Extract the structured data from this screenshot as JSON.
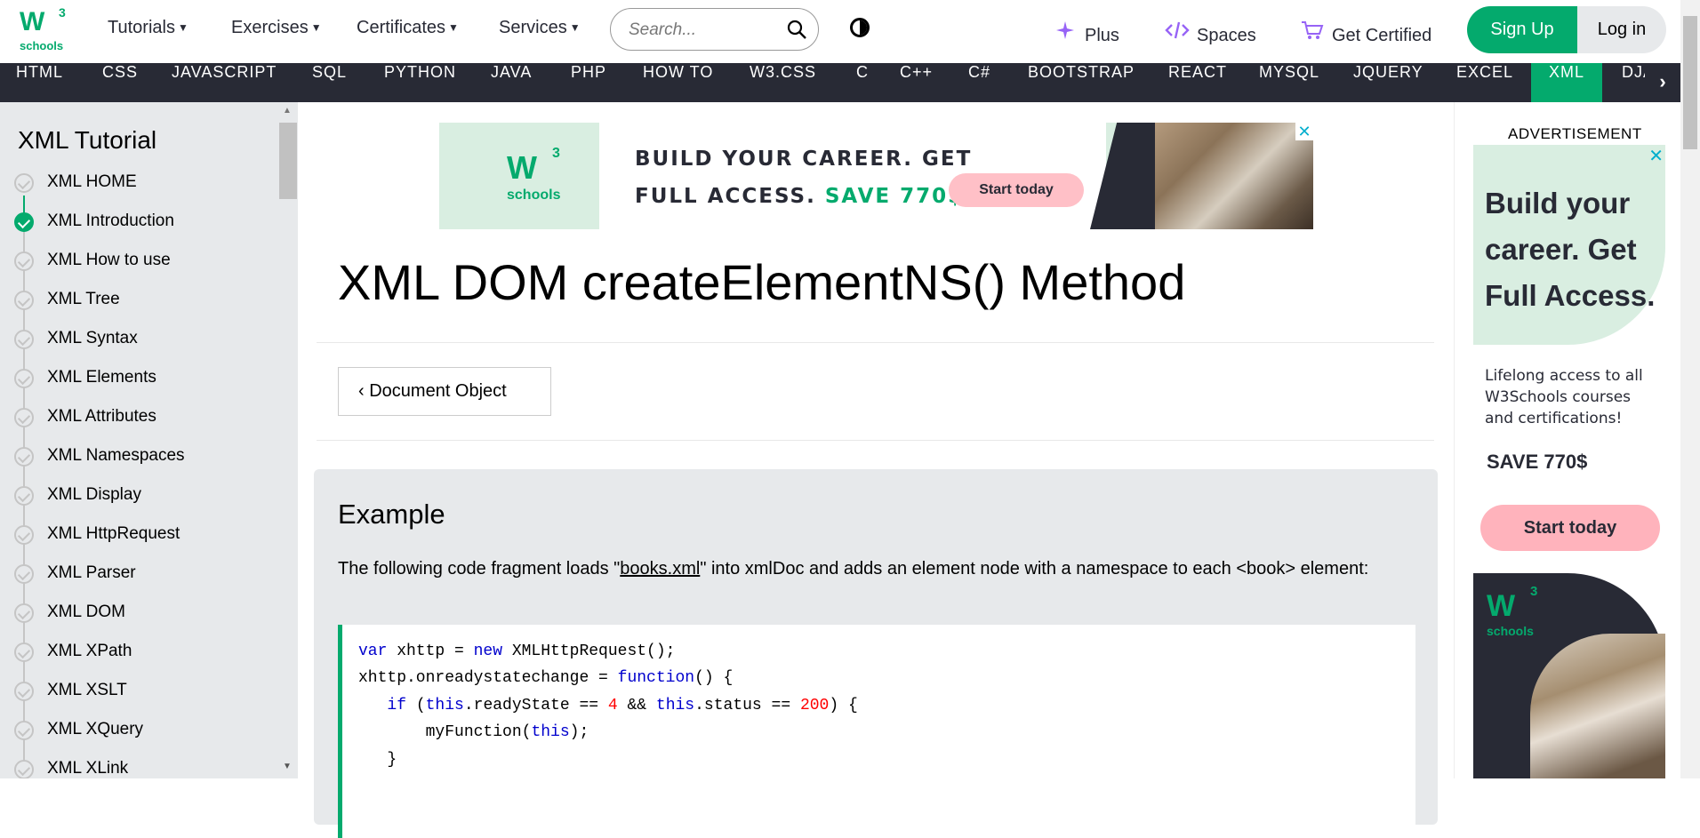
{
  "logo": {
    "mark": "W",
    "sup": "3",
    "text": "schools"
  },
  "topnav": {
    "items": [
      {
        "label": "Tutorials"
      },
      {
        "label": "Exercises"
      },
      {
        "label": "Certificates"
      },
      {
        "label": "Services"
      }
    ],
    "search_placeholder": "Search...",
    "plus": "Plus",
    "spaces": "Spaces",
    "get_certified": "Get Certified",
    "signup": "Sign Up",
    "login": "Log in"
  },
  "subnav": {
    "items": [
      "HTML",
      "CSS",
      "JAVASCRIPT",
      "SQL",
      "PYTHON",
      "JAVA",
      "PHP",
      "HOW TO",
      "W3.CSS",
      "C",
      "C++",
      "C#",
      "BOOTSTRAP",
      "REACT",
      "MYSQL",
      "JQUERY",
      "EXCEL",
      "XML",
      "DJA"
    ],
    "active": "XML",
    "more": "›"
  },
  "sidebar": {
    "title": "XML Tutorial",
    "items": [
      {
        "label": "XML HOME",
        "done": false
      },
      {
        "label": "XML Introduction",
        "done": true
      },
      {
        "label": "XML How to use",
        "done": false
      },
      {
        "label": "XML Tree",
        "done": false
      },
      {
        "label": "XML Syntax",
        "done": false
      },
      {
        "label": "XML Elements",
        "done": false
      },
      {
        "label": "XML Attributes",
        "done": false
      },
      {
        "label": "XML Namespaces",
        "done": false
      },
      {
        "label": "XML Display",
        "done": false
      },
      {
        "label": "XML HttpRequest",
        "done": false
      },
      {
        "label": "XML Parser",
        "done": false
      },
      {
        "label": "XML DOM",
        "done": false
      },
      {
        "label": "XML XPath",
        "done": false
      },
      {
        "label": "XML XSLT",
        "done": false
      },
      {
        "label": "XML XQuery",
        "done": false
      },
      {
        "label": "XML XLink",
        "done": false
      }
    ]
  },
  "banner_ad": {
    "logo_mark": "W",
    "logo_sup": "3",
    "logo_text": "schools",
    "line1": "BUILD YOUR CAREER. GET",
    "line2_prefix": "FULL ACCESS. ",
    "line2_save": "SAVE 770$",
    "cta": "Start today",
    "close": "✕"
  },
  "main": {
    "title": "XML DOM createElementNS() Method",
    "back_button": "Document Object",
    "example": {
      "heading": "Example",
      "desc_prefix": "The following code fragment loads \"",
      "desc_link": "books.xml",
      "desc_suffix": "\" into xmlDoc and adds an element node with a namespace to each <book> element:"
    }
  },
  "code_lines": [
    "var xhttp = new XMLHttpRequest();",
    "xhttp.onreadystatechange = function() {",
    "   if (this.readyState == 4 && this.status == 200) {",
    "       myFunction(this);",
    "   }"
  ],
  "right_ad": {
    "label": "ADVERTISEMENT",
    "close": "✕",
    "headline": "Build your career. Get Full Access.",
    "body": "Lifelong access to all W3Schools courses and certifications!",
    "save": "SAVE 770$",
    "cta": "Start today",
    "logo_mark": "W",
    "logo_sup": "3",
    "logo_text": "schools"
  },
  "colors": {
    "brand_green": "#04AA6D",
    "nav_dark": "#282A35",
    "sidebar_bg": "#E7E9EB",
    "cta_pink": "#FFC0C7"
  }
}
